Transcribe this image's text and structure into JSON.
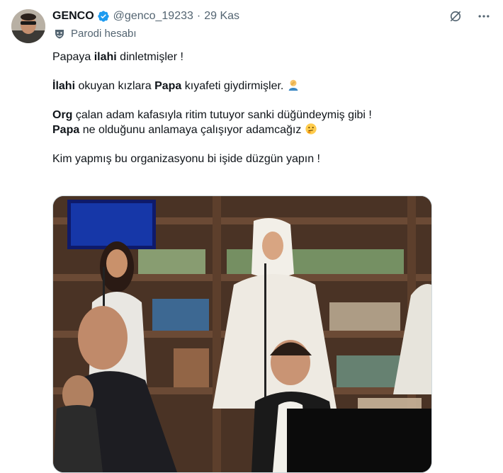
{
  "author": {
    "name": "GENCO",
    "handle": "@genco_19233",
    "separator": "·",
    "date": "29 Kas",
    "label": "Parodi hesabı"
  },
  "tweet": {
    "p1": [
      "Papaya ",
      "ilahi",
      " dinletmişler !"
    ],
    "p2": [
      "İlahi",
      " okuyan  kızlara ",
      "Papa",
      " kıyafeti giydirmişler. "
    ],
    "p3": [
      "Org",
      " çalan adam kafasıyla ritim tutuyor sanki düğündeymiş gibi !"
    ],
    "p4": [
      "Papa",
      " ne olduğunu anlamaya çalışıyor adamcağız "
    ],
    "p5": "Kim yapmış bu organizasyonu bi işide düzgün yapın !"
  },
  "icons": {
    "verified": "verified-badge-icon",
    "parody": "parody-mask-icon",
    "grok": "grok-icon",
    "more": "more-icon",
    "emoji1": "facepalm-emoji",
    "emoji2": "thinking-emoji"
  },
  "colors": {
    "accent": "#1d9bf0",
    "text": "#0f1419",
    "secondary": "#536471"
  }
}
